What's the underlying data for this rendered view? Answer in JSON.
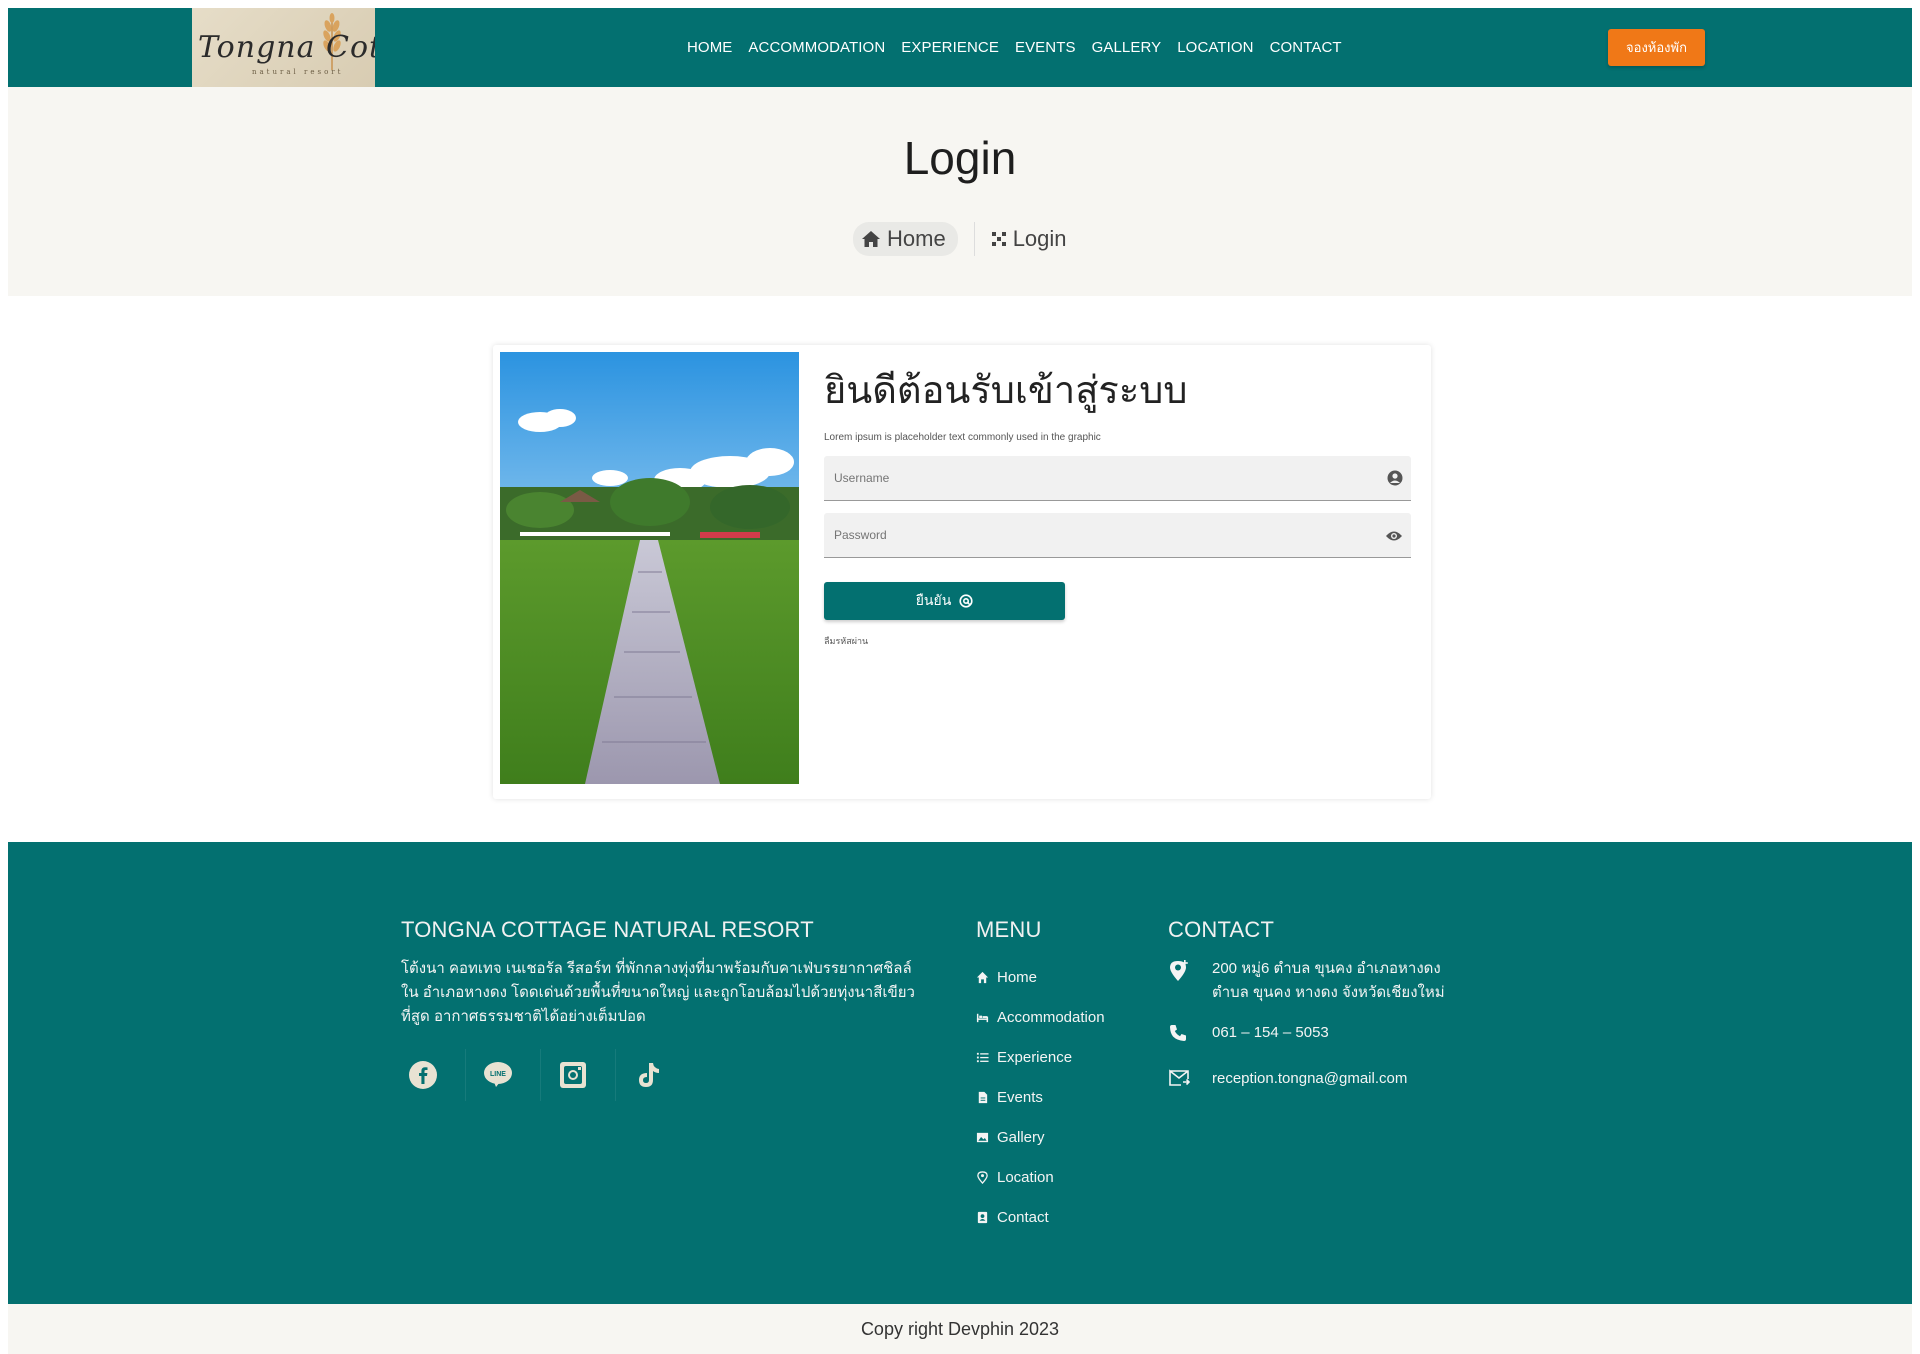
{
  "nav": {
    "logo_text": "Tongna Cottage",
    "logo_sub": "natural resort",
    "items": [
      "HOME",
      "ACCOMMODATION",
      "EXPERIENCE",
      "EVENTS",
      "GALLERY",
      "LOCATION",
      "CONTACT"
    ],
    "book_label": "จองห้องพัก"
  },
  "hero": {
    "title": "Login",
    "breadcrumb_home": "Home",
    "breadcrumb_current": "Login"
  },
  "login": {
    "heading": "ยินดีต้อนรับเข้าสู่ระบบ",
    "lead": "Lorem ipsum is placeholder text commonly used in the graphic",
    "username_placeholder": "Username",
    "password_placeholder": "Password",
    "confirm_label": "ยืนยัน",
    "forgot_label": "ลืมรหัสผ่าน"
  },
  "footer": {
    "about_title": "TONGNA COTTAGE NATURAL RESORT",
    "about_text": "โต้งนา คอทเทจ เนเชอรัล รีสอร์ท ที่พักกลางทุ่งที่มาพร้อมกับคาเฟ่บรรยากาศชิลล์ใน อำเภอหางดง โดดเด่นด้วยพื้นที่ขนาดใหญ่ และถูกโอบล้อมไปด้วยทุ่งนาสีเขียว ที่สูด อากาศธรรมชาติได้อย่างเต็มปอด",
    "socials": [
      "facebook-icon",
      "line-icon",
      "instagram-icon",
      "tiktok-icon"
    ],
    "menu_title": "MENU",
    "menu_items": [
      "Home",
      "Accommodation",
      "Experience",
      "Events",
      "Gallery",
      "Location",
      "Contact"
    ],
    "contact_title": "CONTACT",
    "address_line1": "200 หมู่6 ตำบล ขุนคง อำเภอหางดง",
    "address_line2": "ตำบล ขุนคง หางดง จังหวัดเชียงใหม่",
    "phone": "061 – 154 – 5053",
    "email": "reception.tongna@gmail.com"
  },
  "copyright": "Copy right Devphin 2023",
  "colors": {
    "primary": "#037070",
    "accent": "#f07817",
    "hero_bg": "#f7f6f2"
  }
}
